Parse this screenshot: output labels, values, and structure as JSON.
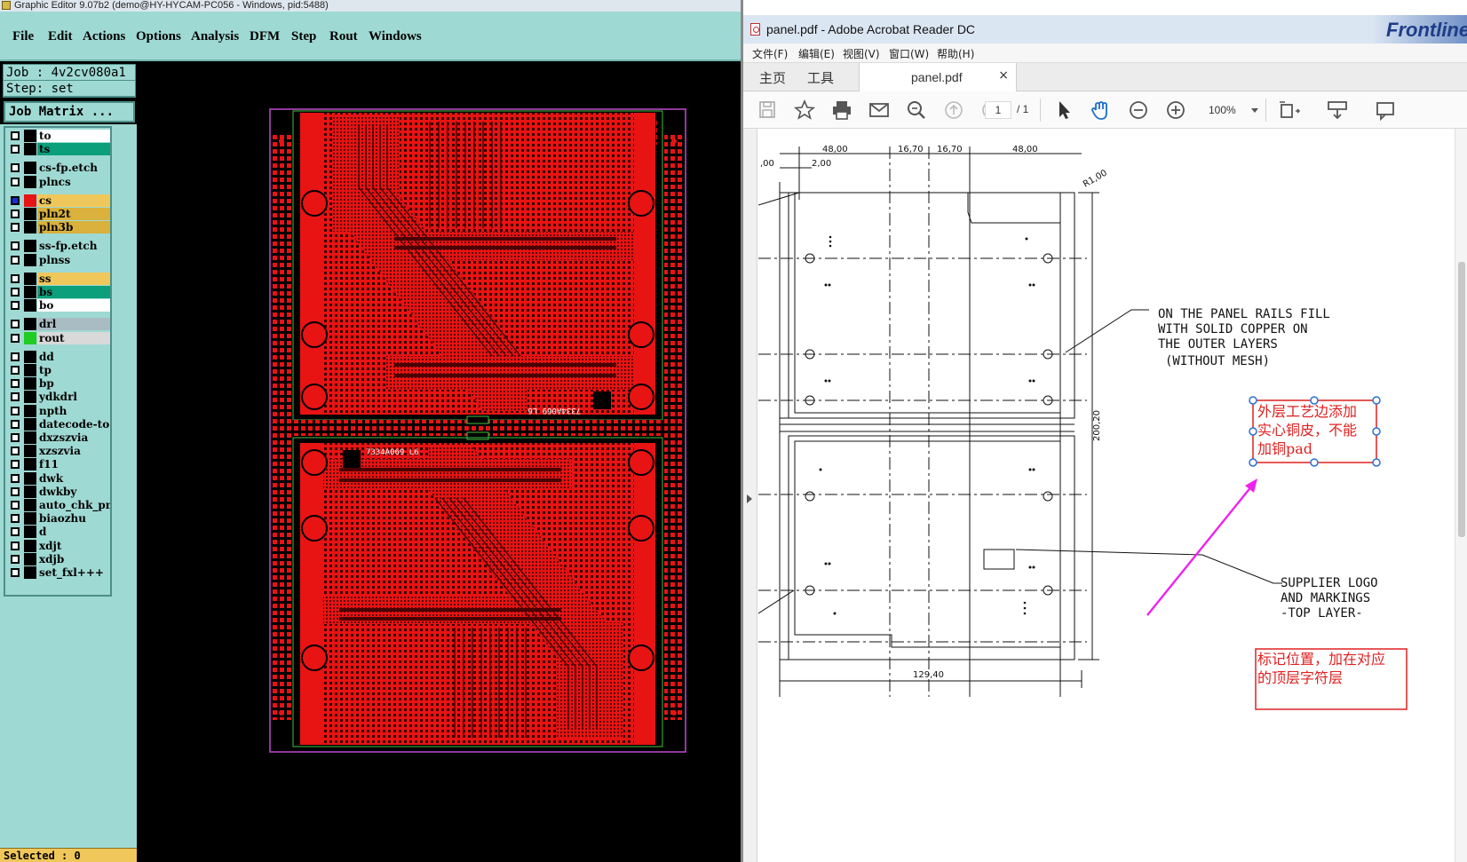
{
  "left_window": {
    "title": "Graphic Editor 9.07b2 (demo@HY-HYCAM-PC056 - Windows, pid:5488)",
    "menu": [
      "File",
      "Edit",
      "Actions",
      "Options",
      "Analysis",
      "DFM",
      "Step",
      "Rout",
      "Windows"
    ],
    "job_label": "Job : 4v2cv080a1",
    "step_label": "Step: set",
    "job_matrix_button": "Job Matrix ...",
    "status": "Selected : 0",
    "board_marks": {
      "top_board_code": "7334A069 L6",
      "bottom_board_code": "7334A069 L6"
    },
    "layers": [
      {
        "name": "to",
        "color": "#ffffff",
        "swatch": "#000000"
      },
      {
        "name": "ts",
        "color": "#0b9f7c",
        "swatch": "#000000"
      },
      {
        "name": "cs-fp.etch",
        "color": "#9fd9d3",
        "swatch": "#000000"
      },
      {
        "name": "plncs",
        "color": "#9fd9d3",
        "swatch": "#000000"
      },
      {
        "name": "cs",
        "color": "#f0c75a",
        "swatch": "#e81313",
        "selected": true
      },
      {
        "name": "pln2t",
        "color": "#d9b13c",
        "swatch": "#000000"
      },
      {
        "name": "pln3b",
        "color": "#d9b13c",
        "swatch": "#000000"
      },
      {
        "name": "ss-fp.etch",
        "color": "#9fd9d3",
        "swatch": "#000000"
      },
      {
        "name": "plnss",
        "color": "#9fd9d3",
        "swatch": "#000000"
      },
      {
        "name": "ss",
        "color": "#f0c75a",
        "swatch": "#000000"
      },
      {
        "name": "bs",
        "color": "#0b9f7c",
        "swatch": "#000000"
      },
      {
        "name": "bo",
        "color": "#ffffff",
        "swatch": "#000000"
      },
      {
        "name": "drl",
        "color": "#a9bcc4",
        "swatch": "#000000"
      },
      {
        "name": "rout",
        "color": "#d9d9d9",
        "swatch": "#22cc22"
      },
      {
        "name": "dd",
        "color": "#9fd9d3",
        "swatch": "#000000"
      },
      {
        "name": "tp",
        "color": "#9fd9d3",
        "swatch": "#000000"
      },
      {
        "name": "bp",
        "color": "#9fd9d3",
        "swatch": "#000000"
      },
      {
        "name": "ydkdrl",
        "color": "#9fd9d3",
        "swatch": "#000000"
      },
      {
        "name": "npth",
        "color": "#9fd9d3",
        "swatch": "#000000"
      },
      {
        "name": "datecode-to",
        "color": "#9fd9d3",
        "swatch": "#000000"
      },
      {
        "name": "dxzszvia",
        "color": "#9fd9d3",
        "swatch": "#000000"
      },
      {
        "name": "xzszvia",
        "color": "#9fd9d3",
        "swatch": "#000000"
      },
      {
        "name": "f11",
        "color": "#9fd9d3",
        "swatch": "#000000"
      },
      {
        "name": "dwk",
        "color": "#9fd9d3",
        "swatch": "#000000"
      },
      {
        "name": "dwkby",
        "color": "#9fd9d3",
        "swatch": "#000000"
      },
      {
        "name": "auto_chk_pnl",
        "color": "#9fd9d3",
        "swatch": "#000000"
      },
      {
        "name": "biaozhu",
        "color": "#9fd9d3",
        "swatch": "#000000"
      },
      {
        "name": "d",
        "color": "#9fd9d3",
        "swatch": "#000000"
      },
      {
        "name": "xdjt",
        "color": "#9fd9d3",
        "swatch": "#000000"
      },
      {
        "name": "xdjb",
        "color": "#9fd9d3",
        "swatch": "#000000"
      },
      {
        "name": "set_fxl+++",
        "color": "#9fd9d3",
        "swatch": "#000000"
      }
    ]
  },
  "right_window": {
    "title": "panel.pdf - Adobe Acrobat Reader DC",
    "brand": "Frontline",
    "menu": [
      "文件(F)",
      "编辑(E)",
      "视图(V)",
      "窗口(W)",
      "帮助(H)"
    ],
    "tabs": {
      "home": "主页",
      "tools": "工具",
      "document": "panel.pdf",
      "close": "×"
    },
    "page_current": "1",
    "page_total": "/ 1",
    "zoom": "100%",
    "drawing": {
      "dims_top": [
        "48,00",
        "16,70",
        "16,70",
        "48,00"
      ],
      "dim_left_a": ",00",
      "dim_left_b": "2,00",
      "radius": "R1,00",
      "height": "200,20",
      "width": "129,40",
      "note_rails": [
        "ON THE PANEL RAILS FILL",
        "WITH SOLID COPPER ON",
        "THE OUTER LAYERS",
        "(WITHOUT MESH)"
      ],
      "note_logo": [
        "SUPPLIER LOGO",
        "AND MARKINGS",
        "-TOP LAYER-"
      ],
      "annot_copper": [
        "外层工艺边添加",
        "实心铜皮，不能",
        "加铜pad"
      ],
      "annot_marking": [
        "标记位置，加在对应",
        "的顶层字符层"
      ]
    }
  },
  "colors": {
    "copper": "#e81313",
    "outline_magenta": "#c04ad0",
    "rail_green": "#3fbf3f",
    "annot_red": "#e02020",
    "arrow_magenta": "#ee22ee"
  }
}
